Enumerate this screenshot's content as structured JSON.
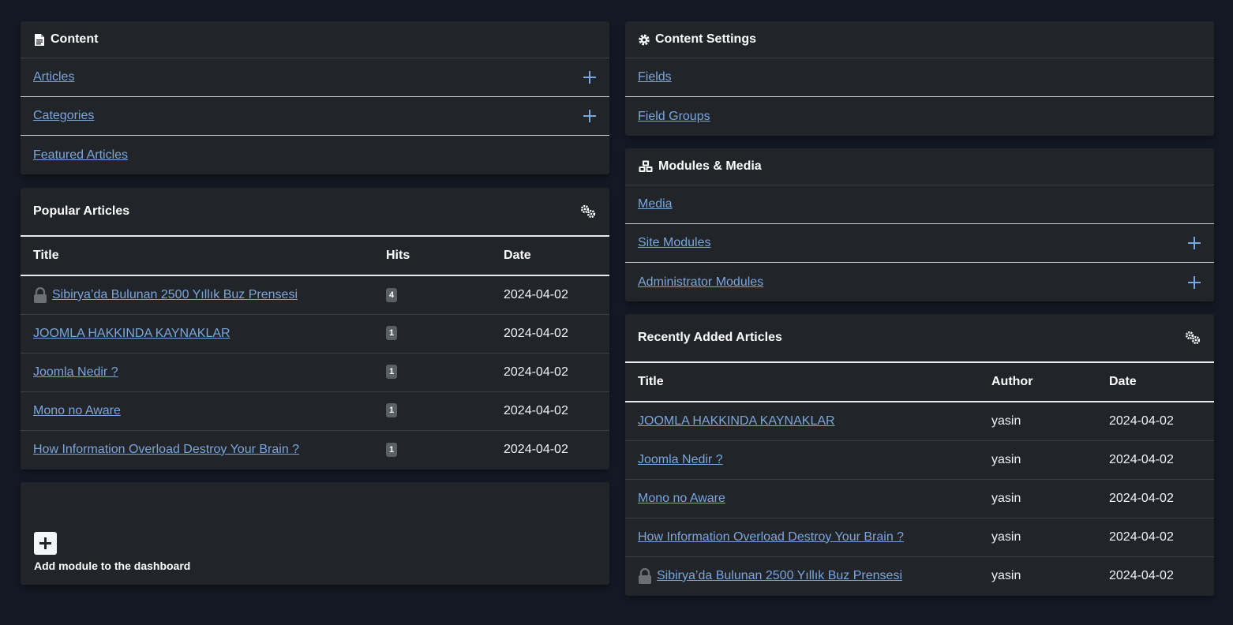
{
  "content_card": {
    "title": "Content",
    "items": [
      {
        "label": "Articles",
        "has_add": true
      },
      {
        "label": "Categories",
        "has_add": true
      },
      {
        "label": "Featured Articles",
        "has_add": false
      }
    ]
  },
  "content_settings_card": {
    "title": "Content Settings",
    "items": [
      {
        "label": "Fields"
      },
      {
        "label": "Field Groups"
      }
    ]
  },
  "modules_media_card": {
    "title": "Modules & Media",
    "items": [
      {
        "label": "Media",
        "has_add": false
      },
      {
        "label": "Site Modules",
        "has_add": true
      },
      {
        "label": "Administrator Modules",
        "has_add": true
      }
    ]
  },
  "popular_articles": {
    "title": "Popular Articles",
    "columns": [
      "Title",
      "Hits",
      "Date"
    ],
    "rows": [
      {
        "title": "Sibirya’da Bulunan 2500 Yıllık Buz Prensesi",
        "locked": true,
        "hits": "4",
        "date": "2024-04-02"
      },
      {
        "title": "JOOMLA HAKKINDA KAYNAKLAR",
        "locked": false,
        "hits": "1",
        "date": "2024-04-02"
      },
      {
        "title": "Joomla Nedir ?",
        "locked": false,
        "hits": "1",
        "date": "2024-04-02"
      },
      {
        "title": "Mono no Aware",
        "locked": false,
        "hits": "1",
        "date": "2024-04-02"
      },
      {
        "title": "How Information Overload Destroy Your Brain ?",
        "locked": false,
        "hits": "1",
        "date": "2024-04-02"
      }
    ]
  },
  "recent_articles": {
    "title": "Recently Added Articles",
    "columns": [
      "Title",
      "Author",
      "Date"
    ],
    "rows": [
      {
        "title": "JOOMLA HAKKINDA KAYNAKLAR",
        "locked": false,
        "author": "yasin",
        "date": "2024-04-02"
      },
      {
        "title": "Joomla Nedir ?",
        "locked": false,
        "author": "yasin",
        "date": "2024-04-02"
      },
      {
        "title": "Mono no Aware",
        "locked": false,
        "author": "yasin",
        "date": "2024-04-02"
      },
      {
        "title": "How Information Overload Destroy Your Brain ?",
        "locked": false,
        "author": "yasin",
        "date": "2024-04-02"
      },
      {
        "title": "Sibirya’da Bulunan 2500 Yıllık Buz Prensesi",
        "locked": true,
        "author": "yasin",
        "date": "2024-04-02"
      }
    ]
  },
  "add_module": {
    "label": "Add module to the dashboard"
  },
  "colors": {
    "background": "#141a25",
    "card": "#212429",
    "link": "#7aa6dc",
    "badge": "#5a5f66"
  }
}
